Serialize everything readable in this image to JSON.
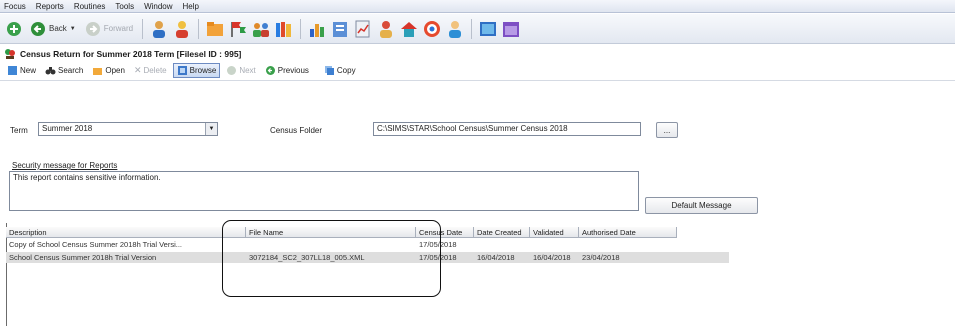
{
  "menu": [
    "Focus",
    "Reports",
    "Routines",
    "Tools",
    "Window",
    "Help"
  ],
  "toolbar": {
    "back_label": "Back",
    "forward_label": "Forward",
    "icons": [
      "home-icon",
      "teacher-icon",
      "pupil-icon",
      "folder-icon",
      "flags-icon",
      "group-icon",
      "books-icon",
      "chart-icon",
      "clipboard-icon",
      "report-icon",
      "people-icon",
      "house-icon",
      "target-icon",
      "person-icon",
      "board-icon",
      "calendar-icon"
    ]
  },
  "window": {
    "title": "Census Return for Summer 2018 Term [Filesel ID : 995]"
  },
  "actions": {
    "new": "New",
    "search": "Search",
    "open": "Open",
    "delete": "Delete",
    "browse": "Browse",
    "next": "Next",
    "previous": "Previous",
    "copy": "Copy"
  },
  "form": {
    "term_label": "Term",
    "term_value": "Summer 2018",
    "census_folder_label": "Census Folder",
    "census_folder_value": "C:\\SIMS\\STAR\\School Census\\Summer Census 2018",
    "browse_button": "...",
    "security_label": "Security message for Reports",
    "security_message": "This report contains sensitive information.",
    "default_message_button": "Default Message"
  },
  "grid": {
    "columns": [
      "Description",
      "File Name",
      "Census Date",
      "Date Created",
      "Validated",
      "Authorised Date"
    ],
    "rows": [
      [
        "Copy of School Census Summer 2018h Trial Versi...",
        "",
        "17/05/2018",
        "",
        "",
        ""
      ],
      [
        "School Census Summer 2018h Trial Version",
        "3072184_SC2_307LL18_005.XML",
        "17/05/2018",
        "16/04/2018",
        "16/04/2018",
        "23/04/2018"
      ]
    ],
    "selected_row": 1
  },
  "colors": {
    "selection": "#dedede",
    "browse_active": "#c9d9f2",
    "annotation": "#111111"
  }
}
